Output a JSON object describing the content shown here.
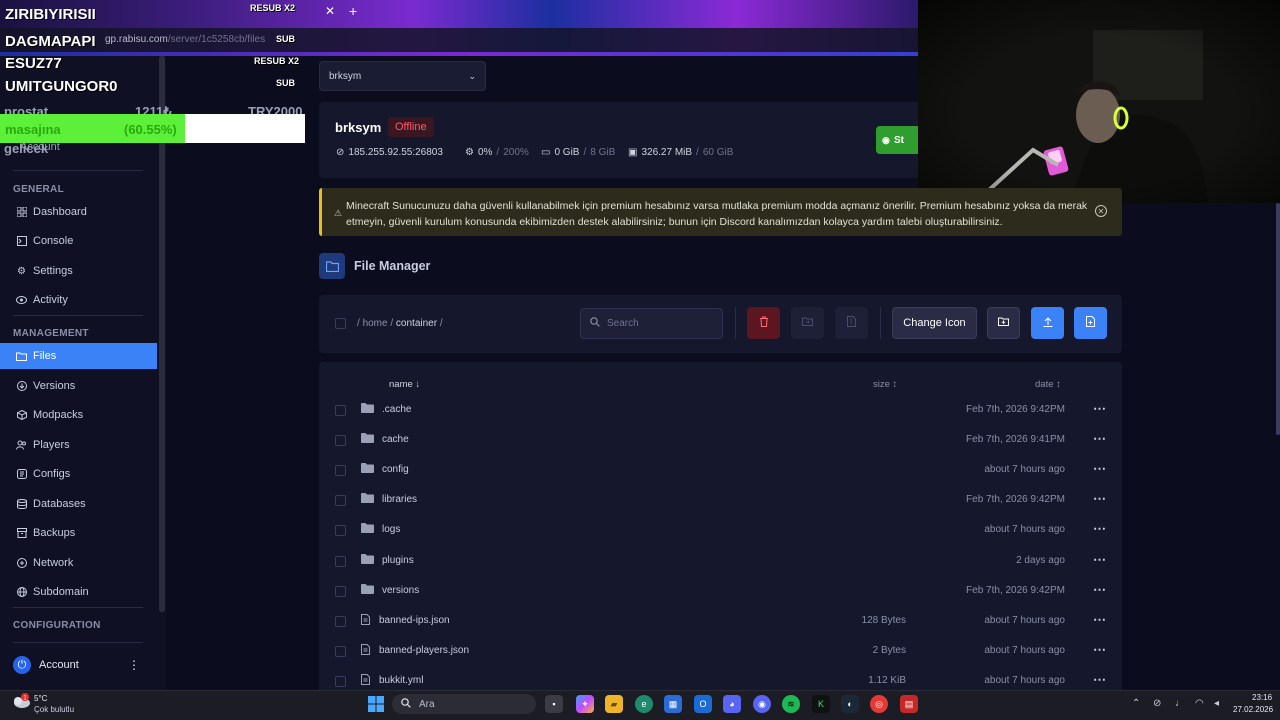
{
  "overlay": {
    "names": [
      "ZIRIBIYIRISII",
      "DAGMAPAPI",
      "ESUZ77",
      "UMITGUNGOR0"
    ],
    "tags": [
      "RESUB X2",
      "SUB",
      "RESUB X2",
      "SUB"
    ],
    "prostat_label": "prostat",
    "prostat_count": "1211₺",
    "prostat_try": "TRY2000",
    "goal_label": "masajına",
    "goal_percent": "(60.55%)",
    "goal_fraction": 0.6055,
    "gelecek": "gelicek",
    "ghost_account": "Account"
  },
  "browser": {
    "url_host": "gp.rabisu.com",
    "url_path": "/server/1c5258cb/files"
  },
  "sidebar": {
    "general_heading": "GENERAL",
    "general_items": [
      {
        "label": "Dashboard",
        "icon": "grid-icon"
      },
      {
        "label": "Console",
        "icon": "terminal-icon"
      },
      {
        "label": "Settings",
        "icon": "gear-icon"
      },
      {
        "label": "Activity",
        "icon": "eye-icon"
      }
    ],
    "management_heading": "MANAGEMENT",
    "management_items": [
      {
        "label": "Files",
        "icon": "folder-icon",
        "active": true
      },
      {
        "label": "Versions",
        "icon": "download-icon"
      },
      {
        "label": "Modpacks",
        "icon": "box-icon"
      },
      {
        "label": "Players",
        "icon": "players-icon"
      },
      {
        "label": "Configs",
        "icon": "sliders-icon"
      },
      {
        "label": "Databases",
        "icon": "database-icon"
      },
      {
        "label": "Backups",
        "icon": "archive-icon"
      },
      {
        "label": "Network",
        "icon": "network-icon"
      },
      {
        "label": "Subdomain",
        "icon": "globe-icon"
      }
    ],
    "configuration_heading": "CONFIGURATION",
    "account_label": "Account"
  },
  "server": {
    "selector_value": "brksym",
    "name": "brksym",
    "status": "Offline",
    "address": "185.255.92.55:26803",
    "cpu": "0%",
    "cpu_limit": "200%",
    "memory": "0 GiB",
    "memory_limit": "8 GiB",
    "disk": "326.27 MiB",
    "disk_limit": "60 GiB",
    "start_label": "St"
  },
  "alert": {
    "text": "Minecraft Sunucunuzu daha güvenli kullanabilmek için premium hesabınız varsa mutlaka premium modda açmanız önerilir. Premium hesabınız yoksa da merak etmeyin, güvenli kurulum konusunda ekibimizden destek alabilirsiniz; bunun için Discord kanalımızdan kolayca yardım talebi oluşturabilirsiniz."
  },
  "file_manager": {
    "title": "File Manager",
    "breadcrumb_sep": "/",
    "breadcrumb_home": "home",
    "breadcrumb_current": "container",
    "search_placeholder": "Search",
    "change_icon_label": "Change Icon",
    "columns": {
      "name": "name ↓",
      "size": "size ↕",
      "date": "date ↕"
    },
    "rows": [
      {
        "name": ".cache",
        "type": "folder",
        "size": "",
        "date": "Feb 7th, 2026 9:42PM"
      },
      {
        "name": "cache",
        "type": "folder",
        "size": "",
        "date": "Feb 7th, 2026 9:41PM"
      },
      {
        "name": "config",
        "type": "folder",
        "size": "",
        "date": "about 7 hours ago"
      },
      {
        "name": "libraries",
        "type": "folder",
        "size": "",
        "date": "Feb 7th, 2026 9:42PM"
      },
      {
        "name": "logs",
        "type": "folder",
        "size": "",
        "date": "about 7 hours ago"
      },
      {
        "name": "plugins",
        "type": "folder",
        "size": "",
        "date": "2 days ago"
      },
      {
        "name": "versions",
        "type": "folder",
        "size": "",
        "date": "Feb 7th, 2026 9:42PM"
      },
      {
        "name": "banned-ips.json",
        "type": "file",
        "size": "128 Bytes",
        "date": "about 7 hours ago"
      },
      {
        "name": "banned-players.json",
        "type": "file",
        "size": "2 Bytes",
        "date": "about 7 hours ago"
      },
      {
        "name": "bukkit.yml",
        "type": "file",
        "size": "1.12 KiB",
        "date": "about 7 hours ago"
      }
    ]
  },
  "taskbar": {
    "temperature": "5°C",
    "condition": "Çok bulutlu",
    "search_placeholder": "Ara",
    "time": "23:16",
    "date": "27.02.2026"
  },
  "colors": {
    "accent": "#3b82f6",
    "offline": "#ff5a6a",
    "start": "#2f9e2f",
    "delete": "#7a1a24",
    "warning": "#e6c11a"
  }
}
